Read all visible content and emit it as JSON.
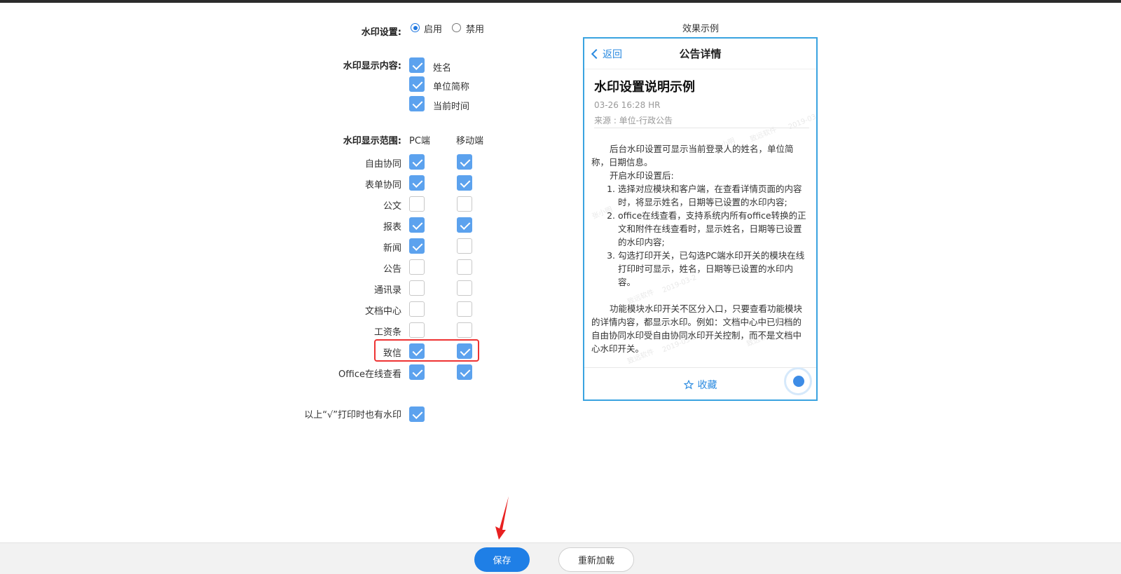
{
  "watermark_setting": {
    "label": "水印设置:",
    "options": [
      "启用",
      "禁用"
    ],
    "selected": "启用"
  },
  "display_content": {
    "label": "水印显示内容:",
    "items": [
      {
        "label": "姓名",
        "checked": true
      },
      {
        "label": "单位简称",
        "checked": true
      },
      {
        "label": "当前时间",
        "checked": true
      }
    ]
  },
  "display_scope": {
    "label": "水印显示范围:",
    "col_pc": "PC端",
    "col_mobile": "移动端",
    "rows": [
      {
        "label": "自由协同",
        "pc": true,
        "mobile": true
      },
      {
        "label": "表单协同",
        "pc": true,
        "mobile": true
      },
      {
        "label": "公文",
        "pc": false,
        "mobile": false
      },
      {
        "label": "报表",
        "pc": true,
        "mobile": true
      },
      {
        "label": "新闻",
        "pc": true,
        "mobile": false
      },
      {
        "label": "公告",
        "pc": false,
        "mobile": false
      },
      {
        "label": "通讯录",
        "pc": false,
        "mobile": false
      },
      {
        "label": "文档中心",
        "pc": false,
        "mobile": false
      },
      {
        "label": "工资条",
        "pc": false,
        "mobile": false
      },
      {
        "label": "致信",
        "pc": true,
        "mobile": true,
        "highlighted": true
      },
      {
        "label": "Office在线查看",
        "pc": true,
        "mobile": true
      }
    ]
  },
  "print_watermark": {
    "label": "以上“√”打印时也有水印",
    "checked": true
  },
  "preview": {
    "title": "效果示例",
    "back": "返回",
    "nav_title": "公告详情",
    "article_title": "水印设置说明示例",
    "meta_time": "03-26 16:28  HR",
    "meta_source": "来源 : 单位-行政公告",
    "intro": "后台水印设置可显示当前登录人的姓名，单位简称，日期信息。",
    "open_after": "开启水印设置后:",
    "list": [
      "选择对应模块和客户端，在查看详情页面的内容时，将显示姓名，日期等已设置的水印内容;",
      "office在线查看，支持系统内所有office转换的正文和附件在线查看时，显示姓名，日期等已设置的水印内容;",
      "勾选打印开关，已勾选PC端水印开关的模块在线打印时可显示，姓名，日期等已设置的水印内容。"
    ],
    "note": "功能模块水印开关不区分入口，只要查看功能模块的详情内容，都显示水印。例如：文档中心中已归档的自由协同水印受自由协同水印开关控制，而不是文档中心水印开关。",
    "favorite": "收藏",
    "watermark_texts": [
      "张小明",
      "致远软件",
      "2019-03-2"
    ]
  },
  "actions": {
    "save": "保存",
    "reload": "重新加载"
  },
  "colors": {
    "checkbox_on": "#5ca2ee",
    "save_button": "#1f7fe6",
    "highlight_border": "#ee3333",
    "preview_border": "#3aa3e0"
  }
}
